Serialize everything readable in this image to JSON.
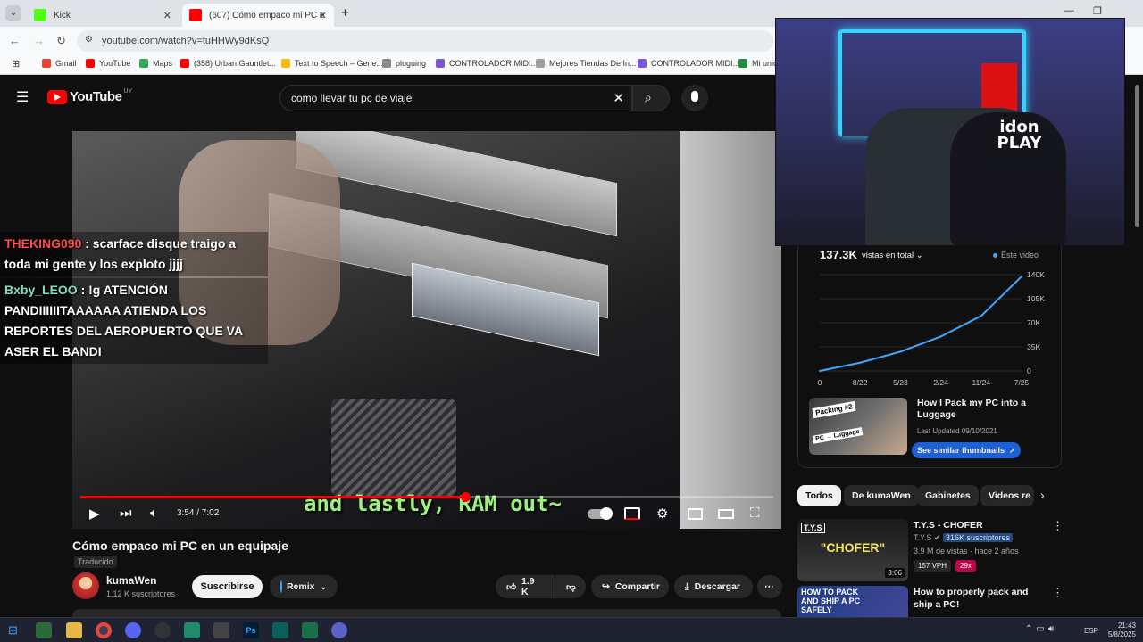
{
  "browser": {
    "tabs": [
      {
        "label": "Kick",
        "active": false
      },
      {
        "label": "(607) Cómo empaco mi PC en un e",
        "active": true
      }
    ],
    "new_tab_icon": "plus-icon",
    "url": "youtube.com/watch?v=tuHHWy9dKsQ",
    "bookmarks": [
      "Gmail",
      "YouTube",
      "Maps",
      "(358) Urban Gauntlet...",
      "Text to Speech – Gene...",
      "pluguing",
      "CONTROLADOR MIDI...",
      "Mejores Tiendas De In...",
      "CONTROLADOR MIDI...",
      "Mi unid"
    ]
  },
  "youtube": {
    "logo_text": "YouTube",
    "region": "UY",
    "search_value": "como llevar tu pc de viaje",
    "chat": [
      {
        "user": "THEKING090",
        "color": "#ff4b4b",
        "text": ": scarface disque traigo a toda mi gente y los exploto jjjj"
      },
      {
        "user": "Bxby_LEOO",
        "color": "#7ee0c0",
        "text": ": !g ATENCIÓN PANDIIIIIITAAAAAA ATIENDA LOS REPORTES DEL AEROPUERTO QUE VA ASER EL BANDI"
      }
    ],
    "caption": "and lastly, RAM out~",
    "progress": 0.555,
    "time": "3:54 / 7:02",
    "video_title": "Cómo empaco mi PC en un equipaje",
    "translated_label": "Traducido",
    "channel_name": "kumaWen",
    "subscribers": "1.12 K suscriptores",
    "subscribe_label": "Suscribirse",
    "remix_label": "Remix",
    "likes": "1.9 K",
    "share_label": "Compartir",
    "download_label": "Descargar"
  },
  "stats": {
    "total_views": "137.3K",
    "views_dropdown": "vistas en total",
    "legend": "Este video",
    "chart_data": {
      "type": "line",
      "x": [
        "0",
        "8/22",
        "5/23",
        "2/24",
        "11/24",
        "7/25"
      ],
      "values": [
        0,
        12000,
        28000,
        50000,
        80000,
        137300
      ],
      "yticks": [
        "140K",
        "105K",
        "70K",
        "35K",
        "0"
      ],
      "ylim": [
        0,
        140000
      ]
    },
    "thumb_card": {
      "title": "How I Pack my PC into a Luggage",
      "updated": "Last Updated 09/10/2021",
      "button": "See similar thumbnails"
    }
  },
  "chips": [
    "Todos",
    "De kumaWen",
    "Gabinetes",
    "Videos re"
  ],
  "recommendations": [
    {
      "title": "T.Y.S - CHOFER",
      "channel": "T.Y.S",
      "channel_subs": "316K suscriptores",
      "meta": "3.9 M de vistas · hace 2 años",
      "vph": "157 VPH",
      "mult": "29x",
      "duration": "3:06",
      "thumb_text": "\"CHOFER\""
    },
    {
      "title": "How to properly pack and ship a PC!",
      "thumb_text": "HOW TO PACK AND SHIP A PC SAFELY"
    }
  ],
  "taskbar": {
    "lang": "ESP",
    "time": "21:43",
    "date": "5/8/2025"
  }
}
